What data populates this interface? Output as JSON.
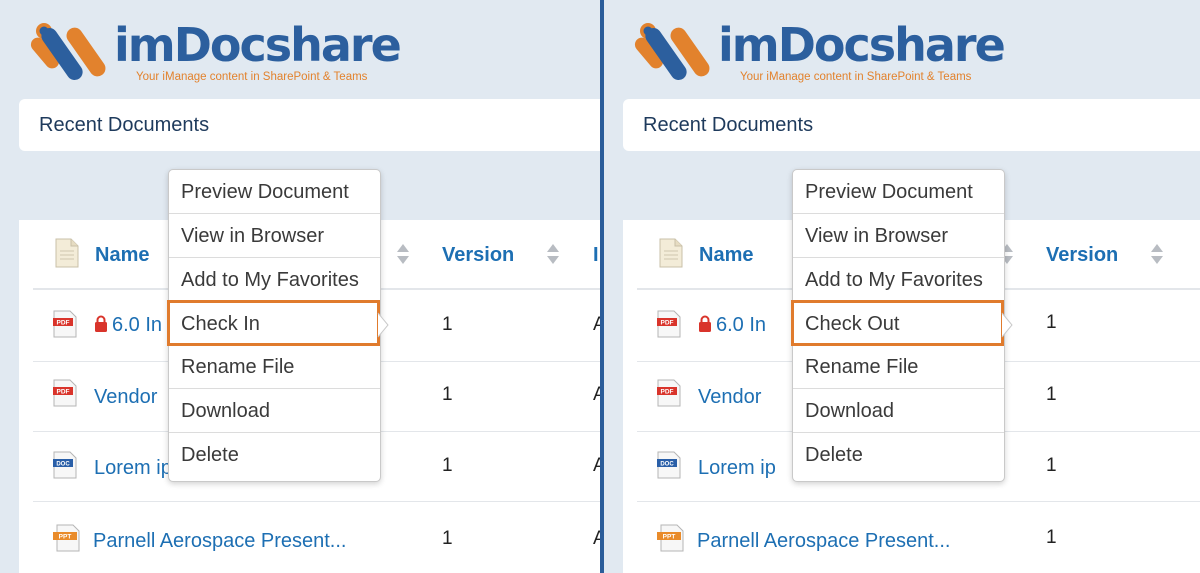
{
  "brand": {
    "name": "imDocshare",
    "tagline": "Your iManage content in SharePoint & Teams",
    "colors": {
      "blue": "#2c5f9e",
      "orange": "#e2822d"
    }
  },
  "panels": [
    {
      "header_title": "Recent Documents",
      "columns": {
        "name": "Name",
        "version": "Version",
        "third_clipped": "I"
      },
      "rows": [
        {
          "icon": "pdf-icon",
          "locked": true,
          "name": "6.0 In",
          "version": "1",
          "third": "A"
        },
        {
          "icon": "pdf-icon",
          "locked": false,
          "name": "Vendor",
          "version": "1",
          "third": "A"
        },
        {
          "icon": "doc-icon",
          "locked": false,
          "name": "Lorem ip",
          "version": "1",
          "third": "A"
        },
        {
          "icon": "ppt-icon",
          "locked": false,
          "name": "Parnell Aerospace Present...",
          "version": "1",
          "third": "A"
        }
      ],
      "context_menu": {
        "items": [
          "Preview Document",
          "View in Browser",
          "Add to My Favorites",
          "Check In",
          "Rename File",
          "Download",
          "Delete"
        ],
        "highlighted": "Check In",
        "highlight_color": "#e07b2d"
      }
    },
    {
      "header_title": "Recent Documents",
      "columns": {
        "name": "Name",
        "version": "Version",
        "third_clipped": ""
      },
      "rows": [
        {
          "icon": "pdf-icon",
          "locked": true,
          "name": "6.0 In",
          "version": "1",
          "third": ""
        },
        {
          "icon": "pdf-icon",
          "locked": false,
          "name": "Vendor",
          "version": "1",
          "third": ""
        },
        {
          "icon": "doc-icon",
          "locked": false,
          "name": "Lorem ip",
          "version": "1",
          "third": ""
        },
        {
          "icon": "ppt-icon",
          "locked": false,
          "name": "Parnell Aerospace Present...",
          "version": "1",
          "third": ""
        }
      ],
      "context_menu": {
        "items": [
          "Preview Document",
          "View in Browser",
          "Add to My Favorites",
          "Check Out",
          "Rename File",
          "Download",
          "Delete"
        ],
        "highlighted": "Check Out",
        "highlight_color": "#e07b2d"
      }
    }
  ]
}
